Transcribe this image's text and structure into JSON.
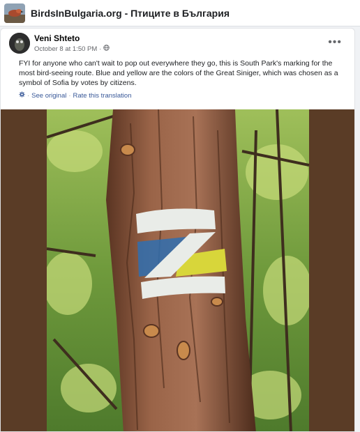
{
  "header": {
    "group_title": "BirdsInBulgaria.org - Птиците в България",
    "group_thumb_icon": "bird-group-thumbnail-icon"
  },
  "post": {
    "author": "Veni Shteto",
    "timestamp": "October 8 at 1:50 PM",
    "separator": "·",
    "privacy_icon": "globe-icon",
    "more_icon": "more-options-icon",
    "more_label": "•••",
    "text": "FYI for anyone who can't wait to pop out everywhere they go, this is South Park's marking for the most bird-seeing route. Blue and yellow are the colors of the Great Siniger, which was chosen as a symbol of Sofia by votes by citizens.",
    "see_original": "See original",
    "rate_translation": "Rate this translation",
    "translate_sep": "·"
  },
  "colors": {
    "link": "#385898",
    "photo_background": "#5a3c26",
    "bark": "#8a5a3c",
    "trail_white": "#e9ece8",
    "trail_blue": "#2f6fb0",
    "trail_yellow": "#d8d63a"
  }
}
